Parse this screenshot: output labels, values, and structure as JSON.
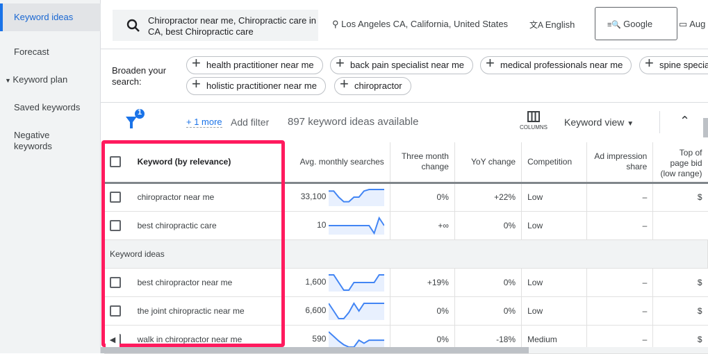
{
  "sidebar": {
    "items": [
      {
        "label": "Keyword ideas"
      },
      {
        "label": "Forecast"
      },
      {
        "label": "Keyword plan"
      },
      {
        "label": "Saved keywords"
      },
      {
        "label": "Negative keywords"
      }
    ]
  },
  "search": {
    "value": "Chiropractor near me, Chiropractic care in CA, best Chiropractic care"
  },
  "location": "Los Angeles CA, California, United States",
  "language": "English",
  "network": "Google",
  "date": "Aug",
  "broaden": {
    "label": "Broaden your search:",
    "chips": [
      "health practitioner near me",
      "back pain specialist near me",
      "medical professionals near me",
      "spine specia",
      "holistic practitioner near me",
      "chiropractor"
    ]
  },
  "toolbar": {
    "filter_badge": "1",
    "more": "+ 1 more",
    "add_filter": "Add filter",
    "count": "897 keyword ideas available",
    "columns": "COLUMNS",
    "view": "Keyword view"
  },
  "table": {
    "headers": [
      "Keyword (by relevance)",
      "Avg. monthly searches",
      "Three month change",
      "YoY change",
      "Competition",
      "Ad impression share",
      "Top of page bid (low range)"
    ],
    "rows": [
      {
        "keyword": "chiropractor near me",
        "avg": "33,100",
        "three": "0%",
        "yoy": "+22%",
        "comp": "Low",
        "ad": "–",
        "top": "$",
        "trend": [
          0.9,
          0.9,
          0.5,
          0.2,
          0.2,
          0.5,
          0.5,
          0.9,
          1,
          1,
          1,
          1
        ]
      },
      {
        "keyword": "best chiropractic care",
        "avg": "10",
        "three": "+∞",
        "yoy": "0%",
        "comp": "Low",
        "ad": "–",
        "top": "",
        "trend": [
          0.5,
          0.5,
          0.5,
          0.5,
          0.5,
          0.5,
          0.5,
          0.5,
          0.5,
          0,
          1,
          0.5
        ]
      },
      {
        "group": "Keyword ideas"
      },
      {
        "keyword": "best chiropractor near me",
        "avg": "1,600",
        "three": "+19%",
        "yoy": "0%",
        "comp": "Low",
        "ad": "–",
        "top": "$",
        "trend": [
          1,
          1,
          0.5,
          0,
          0,
          0.5,
          0.5,
          0.5,
          0.5,
          0.5,
          1,
          1
        ]
      },
      {
        "keyword": "the joint chiropractic near me",
        "avg": "6,600",
        "three": "0%",
        "yoy": "0%",
        "comp": "Low",
        "ad": "–",
        "top": "$",
        "trend": [
          1,
          0.5,
          0,
          0,
          0.4,
          1,
          0.5,
          1,
          1,
          1,
          1,
          1
        ]
      },
      {
        "keyword": "walk in chiropractor near me",
        "avg": "590",
        "three": "0%",
        "yoy": "-18%",
        "comp": "Medium",
        "ad": "–",
        "top": "$",
        "trend": [
          1,
          0.7,
          0.4,
          0.15,
          0,
          0,
          0.45,
          0.25,
          0.45,
          0.45,
          0.45,
          0.45
        ]
      }
    ]
  },
  "colors": {
    "accent": "#1a73e8",
    "highlight": "#ff1a5e"
  }
}
